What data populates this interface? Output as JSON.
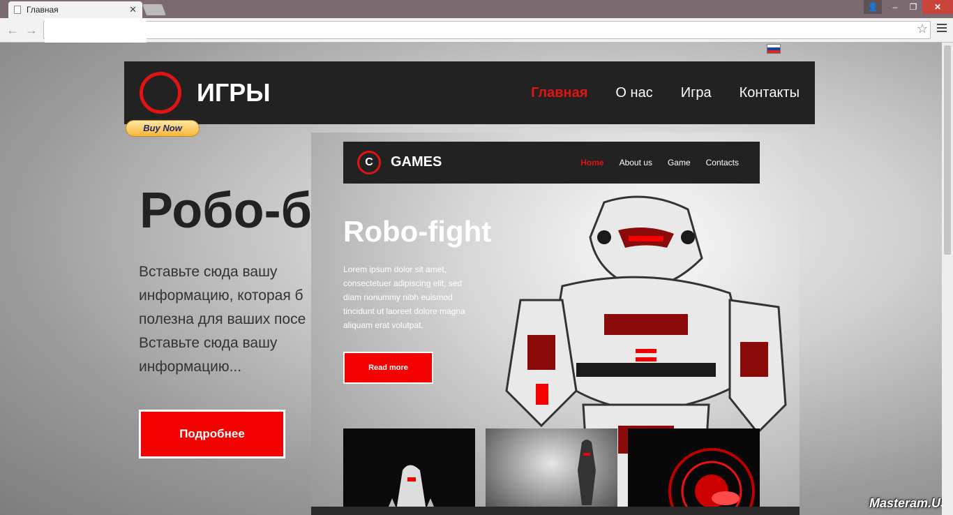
{
  "browser": {
    "tab_title": "Главная",
    "icons": {
      "back": "arrow-left-icon",
      "forward": "arrow-right-icon",
      "star": "star-icon",
      "menu": "hamburger-icon",
      "close": "close-icon"
    }
  },
  "site": {
    "logo_text": "ИГРЫ",
    "nav": [
      "Главная",
      "О нас",
      "Игра",
      "Контакты"
    ],
    "buy_now": "Buy Now",
    "hero_title": "Робо-б",
    "hero_lines": [
      "Вставьте сюда вашу",
      "информацию, которая б",
      "полезна для ваших посе",
      "Вставьте сюда вашу",
      "информацию..."
    ],
    "hero_button": "Подробнее",
    "accent_color": "#e21313"
  },
  "preview": {
    "logo_letter": "C",
    "logo_text": "GAMES",
    "nav": [
      "Home",
      "About us",
      "Game",
      "Contacts"
    ],
    "title": "Robo-fight",
    "text_lines": [
      "Lorem ipsum dolor sit amet,",
      "consectetuer adipiscing elit, sed",
      "diam nonummy nibh euismod",
      "tincidunt ut laoreet dolore magna",
      "aliquam erat volutpat."
    ],
    "button": "Read more"
  },
  "watermark": "Masteram.US"
}
